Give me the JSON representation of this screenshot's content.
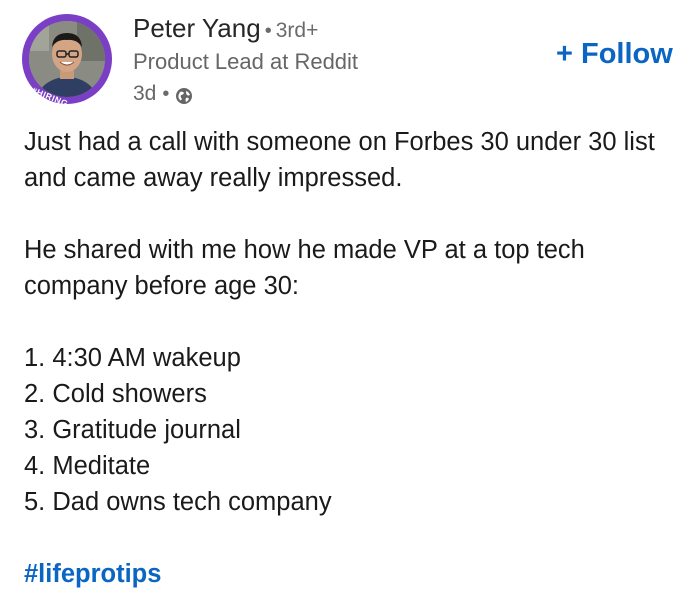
{
  "author": {
    "name": "Peter Yang",
    "connection_degree": "3rd+",
    "headline": "Product Lead at Reddit",
    "hiring_badge": "#HIRING",
    "post_age": "3d",
    "visibility_icon": "globe-icon"
  },
  "actions": {
    "follow_label": "+ Follow"
  },
  "post": {
    "paragraph_1": "Just had a call with someone on Forbes 30 under 30 list and came away really impressed.",
    "paragraph_2": "He shared with me how he made VP at a top tech company before age 30:",
    "list": [
      "1. 4:30 AM wakeup",
      "2. Cold showers",
      "3. Gratitude journal",
      "4. Meditate",
      "5. Dad owns tech company"
    ],
    "hashtag": "#lifeprotips"
  },
  "colors": {
    "link_blue": "#0a66c2",
    "hiring_ring": "#7a3fc4",
    "secondary_text": "#666666"
  }
}
